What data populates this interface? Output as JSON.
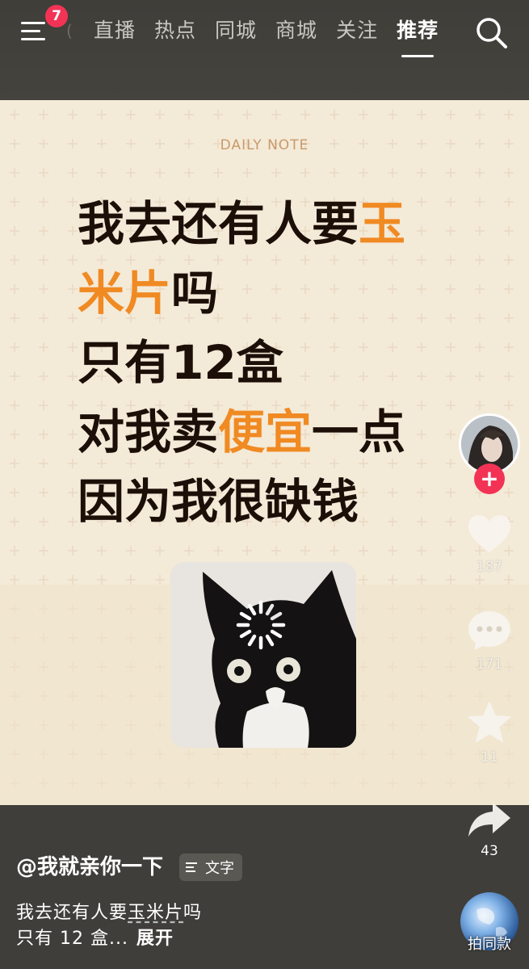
{
  "topbar": {
    "menu_badge": "7",
    "ghost_tab": "(",
    "tabs": [
      {
        "label": "直播"
      },
      {
        "label": "热点"
      },
      {
        "label": "同城"
      },
      {
        "label": "商城"
      },
      {
        "label": "关注"
      },
      {
        "label": "推荐"
      }
    ],
    "active_tab": "推荐",
    "icons": {
      "menu": "menu-icon",
      "search": "search-icon"
    }
  },
  "video": {
    "note_label": "DAILY NOTE",
    "headline": {
      "line1_a": "我去还有人要",
      "line1_b": "玉",
      "line2_a": "米片",
      "line2_b": "吗",
      "line3": "只有12盒",
      "line4_a": "对我卖",
      "line4_b": "便宜",
      "line4_c": "一点",
      "line5": "因为我很缺钱"
    },
    "accent_color": "#f08a23",
    "image": "black-cat-loading-meme"
  },
  "actions": {
    "likes": "187",
    "comments": "171",
    "favorites": "11",
    "shares": "43",
    "follow_symbol": "+",
    "music_label": "拍同款"
  },
  "post": {
    "author": "@我就亲你一下",
    "type_tag": "文字",
    "desc_line1_a": "我去还有人要",
    "desc_line1_kw": "玉米片",
    "desc_line1_b": "吗",
    "desc_line2": "只有 12 盒...",
    "expand_label": "展开"
  },
  "colors": {
    "badge": "#f23355",
    "bar_bg": "#3f3e3a",
    "video_bg": "#f5ecdc"
  }
}
